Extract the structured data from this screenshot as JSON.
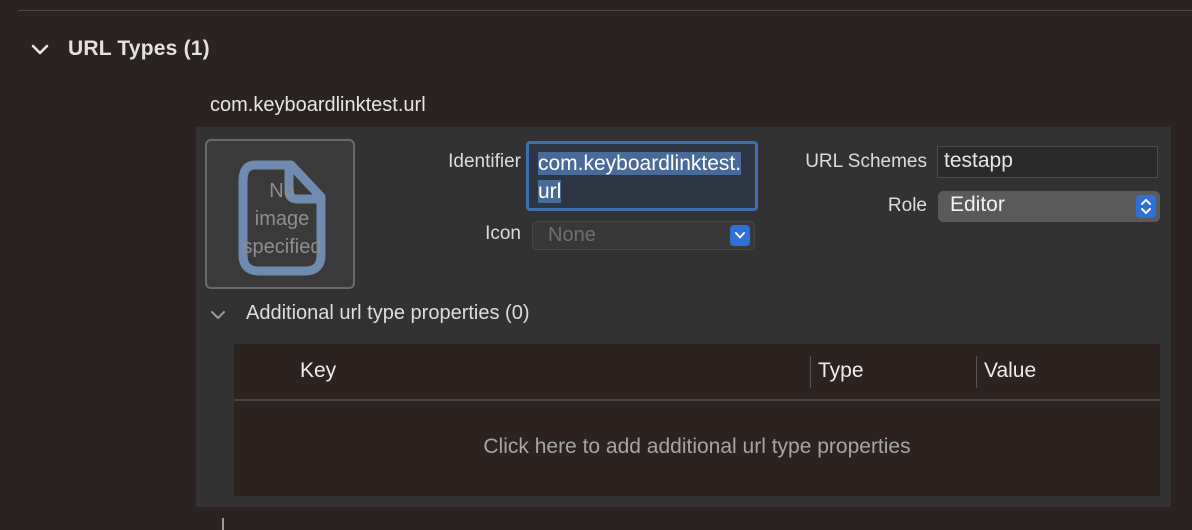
{
  "section": {
    "title": "URL Types (1)",
    "chevron_icon": "chevron-down-icon"
  },
  "entry": {
    "title": "com.keyboardlinktest.url",
    "image_placeholder": "No\nimage\nspecified",
    "image_icon": "document-icon",
    "identifier_label": "Identifier",
    "identifier_value": "com.keyboardlinktest.url",
    "icon_label": "Icon",
    "icon_value": "None",
    "url_schemes_label": "URL Schemes",
    "url_schemes_value": "testapp",
    "role_label": "Role",
    "role_value": "Editor"
  },
  "additional": {
    "title": "Additional url type properties (0)",
    "chevron_icon": "chevron-down-icon",
    "columns": [
      "Key",
      "Type",
      "Value"
    ],
    "empty_hint": "Click here to add additional url type properties"
  },
  "colors": {
    "background": "#2b2322",
    "panel": "#323232",
    "accent": "#2f6fd6",
    "selection": "#4a6a98"
  }
}
